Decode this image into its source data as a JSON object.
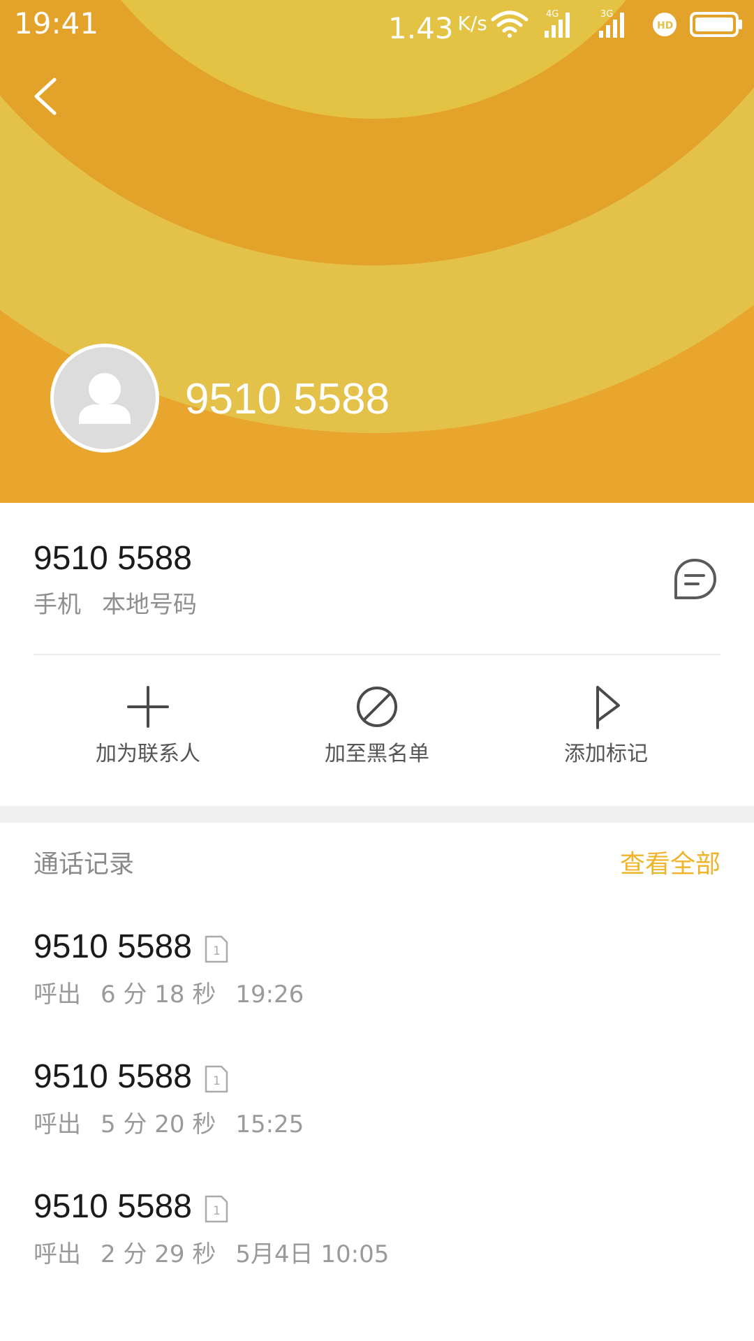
{
  "status_bar": {
    "time": "19:41",
    "speed": "1.43",
    "speed_unit": "K/s",
    "icons": [
      "wifi-icon",
      "signal-4g-icon",
      "signal-3g-icon",
      "hd-icon",
      "battery-icon"
    ]
  },
  "header": {
    "title": "9510 5588",
    "back_icon": "chevron-left-icon",
    "avatar_icon": "person-icon"
  },
  "contact": {
    "number": "9510 5588",
    "type": "手机",
    "location": "本地号码",
    "message_icon": "message-icon"
  },
  "actions": [
    {
      "label": "加为联系人",
      "icon": "plus-icon"
    },
    {
      "label": "加至黑名单",
      "icon": "block-icon"
    },
    {
      "label": "添加标记",
      "icon": "flag-icon"
    }
  ],
  "call_log": {
    "title": "通话记录",
    "view_all": "查看全部",
    "items": [
      {
        "number": "9510 5588",
        "sim": "1",
        "direction": "呼出",
        "duration": "6 分 18 秒",
        "time": "19:26"
      },
      {
        "number": "9510 5588",
        "sim": "1",
        "direction": "呼出",
        "duration": "5 分 20 秒",
        "time": "15:25"
      },
      {
        "number": "9510 5588",
        "sim": "1",
        "direction": "呼出",
        "duration": "2 分 29 秒",
        "time": "5月4日 10:05"
      }
    ]
  },
  "colors": {
    "hero_outer": "#e9a62f",
    "hero_middle": "#e4c24a",
    "hero_ring": "#e3a229",
    "hero_inner": "#e4c244",
    "accent": "#f0b429"
  }
}
